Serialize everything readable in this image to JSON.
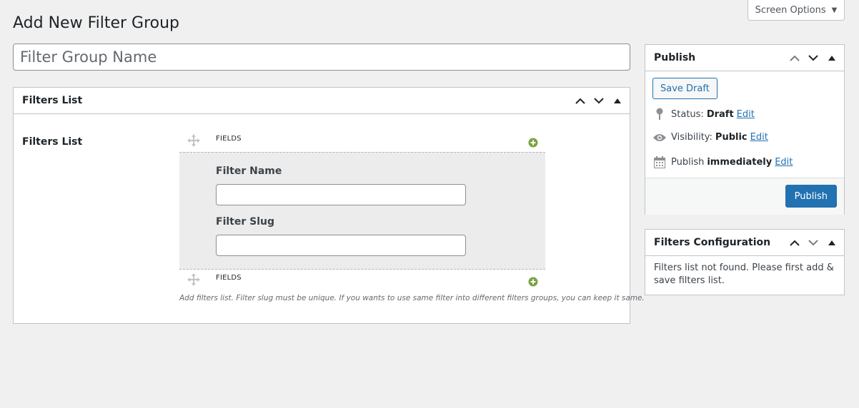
{
  "screen_options": {
    "label": "Screen Options",
    "caret": "▼"
  },
  "page": {
    "title": "Add New Filter Group"
  },
  "title_field": {
    "placeholder": "Filter Group Name",
    "value": ""
  },
  "filters_box": {
    "header": "Filters List",
    "label": "Filters List",
    "row_label_top": "FIELDS",
    "row_label_bottom": "FIELDS",
    "filter_name_label": "Filter Name",
    "filter_name_value": "",
    "filter_slug_label": "Filter Slug",
    "filter_slug_value": "",
    "help": "Add filters list. Filter slug must be unique. If you wants to use same filter into different filters groups, you can keep it same."
  },
  "publish_box": {
    "header": "Publish",
    "save_draft": "Save Draft",
    "status_label": "Status:",
    "status_value": "Draft",
    "visibility_label": "Visibility:",
    "visibility_value": "Public",
    "publish_label": "Publish",
    "publish_value": "immediately",
    "edit": "Edit",
    "publish_button": "Publish"
  },
  "config_box": {
    "header": "Filters Configuration",
    "message": "Filters list not found. Please first add & save filters list."
  },
  "colors": {
    "primary": "#2271b1",
    "plus_green": "#7aa33f"
  }
}
